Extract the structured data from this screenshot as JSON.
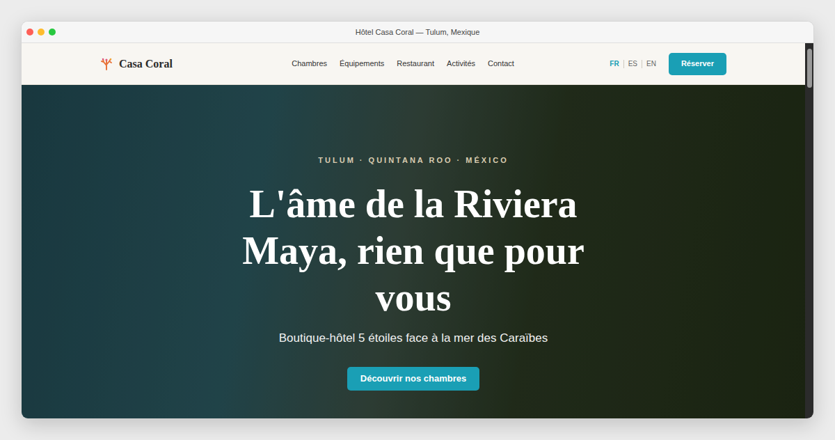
{
  "window": {
    "title": "Hôtel Casa Coral — Tulum, Mexique"
  },
  "nav": {
    "logo": "Casa Coral",
    "links": [
      "Chambres",
      "Équipements",
      "Restaurant",
      "Activités",
      "Contact"
    ],
    "languages": [
      {
        "label": "FR",
        "selected": true
      },
      {
        "label": "ES",
        "selected": false
      },
      {
        "label": "EN",
        "selected": false
      }
    ],
    "cta": "Réserver"
  },
  "hero": {
    "eyebrow": "TULUM · QUINTANA ROO · MÉXICO",
    "title": "L'âme de la Riviera Maya, rien que pour vous",
    "subtitle": "Boutique-hôtel 5 étoiles face à la mer des Caraïbes",
    "cta": "Découvrir nos chambres"
  }
}
